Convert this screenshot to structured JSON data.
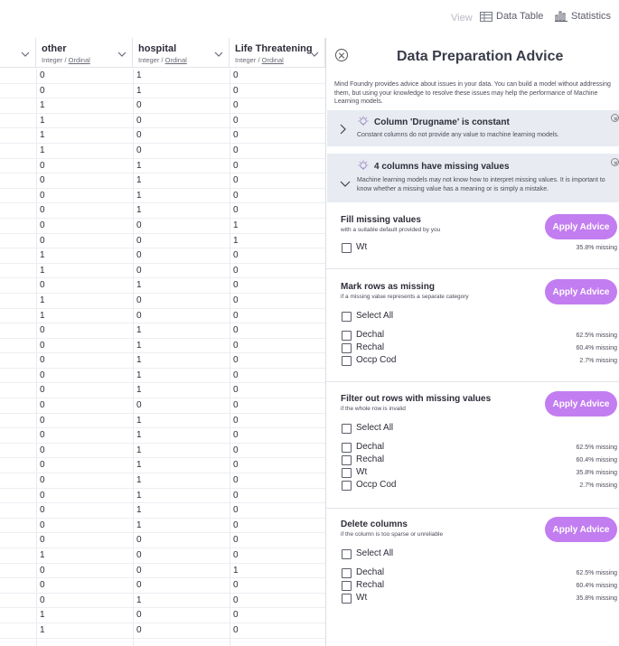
{
  "topbar": {
    "view_label": "View",
    "data_table_label": "Data Table",
    "statistics_label": "Statistics"
  },
  "table": {
    "columns": [
      {
        "name": "other",
        "type": "Integer",
        "subtype": "Ordinal"
      },
      {
        "name": "hospital",
        "type": "Integer",
        "subtype": "Ordinal"
      },
      {
        "name": "Life Threatening",
        "type": "Integer",
        "subtype": "Ordinal"
      }
    ],
    "rows": [
      [
        "0",
        "1",
        "0"
      ],
      [
        "0",
        "1",
        "0"
      ],
      [
        "1",
        "0",
        "0"
      ],
      [
        "1",
        "0",
        "0"
      ],
      [
        "1",
        "0",
        "0"
      ],
      [
        "1",
        "0",
        "0"
      ],
      [
        "0",
        "1",
        "0"
      ],
      [
        "0",
        "1",
        "0"
      ],
      [
        "0",
        "1",
        "0"
      ],
      [
        "0",
        "1",
        "0"
      ],
      [
        "0",
        "0",
        "1"
      ],
      [
        "0",
        "0",
        "1"
      ],
      [
        "1",
        "0",
        "0"
      ],
      [
        "1",
        "0",
        "0"
      ],
      [
        "0",
        "1",
        "0"
      ],
      [
        "1",
        "0",
        "0"
      ],
      [
        "1",
        "0",
        "0"
      ],
      [
        "0",
        "1",
        "0"
      ],
      [
        "0",
        "1",
        "0"
      ],
      [
        "0",
        "1",
        "0"
      ],
      [
        "0",
        "1",
        "0"
      ],
      [
        "0",
        "1",
        "0"
      ],
      [
        "0",
        "0",
        "0"
      ],
      [
        "0",
        "1",
        "0"
      ],
      [
        "0",
        "1",
        "0"
      ],
      [
        "0",
        "1",
        "0"
      ],
      [
        "0",
        "1",
        "0"
      ],
      [
        "0",
        "1",
        "0"
      ],
      [
        "0",
        "1",
        "0"
      ],
      [
        "0",
        "1",
        "0"
      ],
      [
        "0",
        "1",
        "0"
      ],
      [
        "0",
        "0",
        "0"
      ],
      [
        "1",
        "0",
        "0"
      ],
      [
        "0",
        "0",
        "1"
      ],
      [
        "0",
        "0",
        "0"
      ],
      [
        "0",
        "1",
        "0"
      ],
      [
        "1",
        "0",
        "0"
      ],
      [
        "1",
        "0",
        "0"
      ]
    ]
  },
  "panel": {
    "title": "Data Preparation Advice",
    "intro": "Mind Foundry provides advice about issues in your data. You can build a model without addressing them, but using your knowledge to resolve these issues may help the performance of Machine Learning models.",
    "issues": [
      {
        "title": "Column 'Drugname' is constant",
        "desc": "Constant columns do not provide any value to machine learning models."
      },
      {
        "title": "4 columns have missing values",
        "desc": "Machine learning models may not know how to interpret missing values. It is important to know whether a missing value has a meaning or is simply a mistake."
      }
    ],
    "apply_label": "Apply Advice",
    "select_all_label": "Select All",
    "sections": [
      {
        "title": "Fill missing values",
        "sub": "with a suitable default provided by you",
        "items": [
          {
            "label": "Wt",
            "pct": "35.8% missing"
          }
        ]
      },
      {
        "title": "Mark rows as missing",
        "sub": "if a missing value represents a separate category",
        "items": [
          {
            "label": "Dechal",
            "pct": "62.5% missing"
          },
          {
            "label": "Rechal",
            "pct": "60.4% missing"
          },
          {
            "label": "Occp Cod",
            "pct": "2.7% missing"
          }
        ]
      },
      {
        "title": "Filter out rows with missing values",
        "sub": "if the whole row is invalid",
        "items": [
          {
            "label": "Dechal",
            "pct": "62.5% missing"
          },
          {
            "label": "Rechal",
            "pct": "60.4% missing"
          },
          {
            "label": "Wt",
            "pct": "35.8% missing"
          },
          {
            "label": "Occp Cod",
            "pct": "2.7% missing"
          }
        ]
      },
      {
        "title": "Delete columns",
        "sub": "if the column is too sparse or unreliable",
        "items": [
          {
            "label": "Dechal",
            "pct": "62.5% missing"
          },
          {
            "label": "Rechal",
            "pct": "60.4% missing"
          },
          {
            "label": "Wt",
            "pct": "35.8% missing"
          }
        ]
      }
    ]
  }
}
